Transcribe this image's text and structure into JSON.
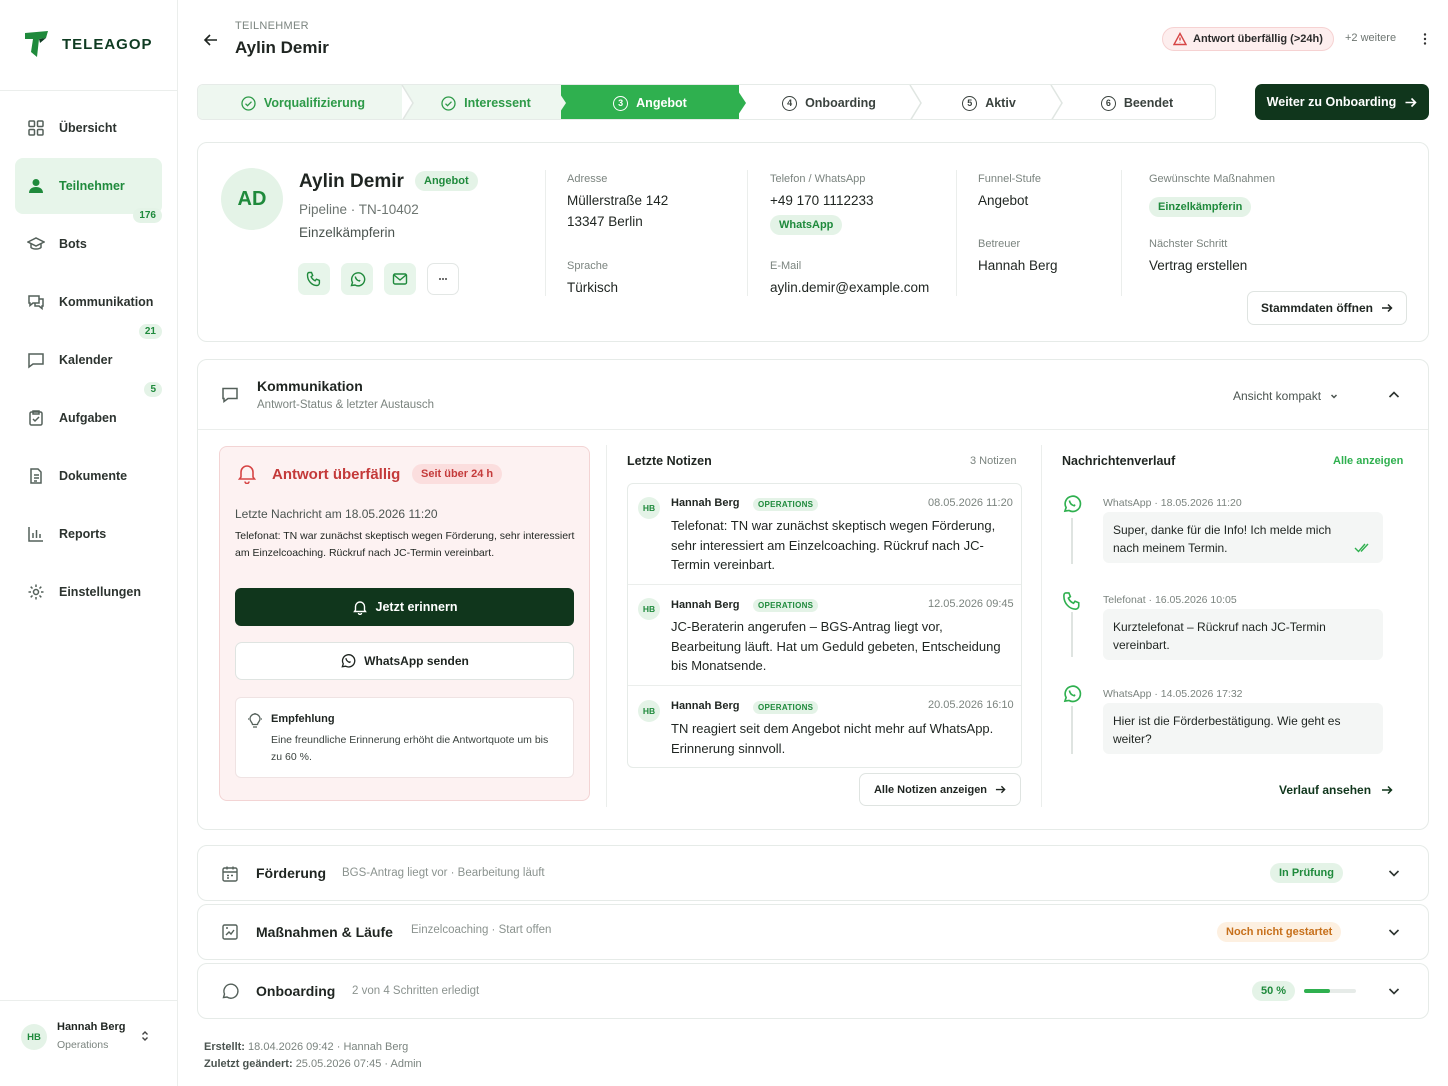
{
  "brand": {
    "name": "TELEAGOP",
    "colors": {
      "primary": "#2fb04f",
      "dark": "#10361c",
      "danger": "#d64545",
      "warning": "#c7701b"
    }
  },
  "sidebar": {
    "items": [
      {
        "label": "Übersicht",
        "icon": "grid-icon"
      },
      {
        "label": "Teilnehmer",
        "icon": "user-icon",
        "badge": "176",
        "active": true
      },
      {
        "label": "Bots",
        "icon": "graduation-cap-icon"
      },
      {
        "label": "Kommunikation",
        "icon": "chat-icon",
        "badge": "21"
      },
      {
        "label": "Kalender",
        "icon": "message-square-icon",
        "badge": "5"
      },
      {
        "label": "Aufgaben",
        "icon": "clipboard-check-icon"
      },
      {
        "label": "Dokumente",
        "icon": "document-icon"
      },
      {
        "label": "Reports",
        "icon": "bar-chart-icon"
      },
      {
        "label": "Einstellungen",
        "icon": "gear-icon"
      }
    ],
    "user": {
      "initials": "HB",
      "name": "Hannah Berg",
      "role": "Operations"
    }
  },
  "header": {
    "kicker": "TEILNEHMER",
    "title": "Aylin Demir",
    "alert": "Antwort überfällig (>24h)",
    "more": "+2 weitere"
  },
  "stepper": {
    "steps": [
      {
        "label": "Vorqualifizierung",
        "state": "done"
      },
      {
        "label": "Interessent",
        "state": "done"
      },
      {
        "num": "3",
        "label": "Angebot",
        "state": "current"
      },
      {
        "num": "4",
        "label": "Onboarding",
        "state": "todo"
      },
      {
        "num": "5",
        "label": "Aktiv",
        "state": "todo"
      },
      {
        "num": "6",
        "label": "Beendet",
        "state": "todo"
      }
    ],
    "next_button": "Weiter zu Onboarding"
  },
  "profile": {
    "initials": "AD",
    "name": "Aylin Demir",
    "status": "Angebot",
    "pipeline": "Pipeline · TN-10402",
    "role": "Einzelkämpferin",
    "address_label": "Adresse",
    "address_line1": "Müllerstraße 142",
    "address_line2": "13347 Berlin",
    "language_label": "Sprache",
    "language": "Türkisch",
    "phone_label": "Telefon / WhatsApp",
    "phone": "+49 170 1112233",
    "phone_tag": "WhatsApp",
    "email_label": "E-Mail",
    "email": "aylin.demir@example.com",
    "funnel_label": "Funnel-Stufe",
    "funnel": "Angebot",
    "owner_label": "Betreuer",
    "owner": "Hannah Berg",
    "measures_label": "Gewünschte Maßnahmen",
    "measures_tag": "Einzelkämpferin",
    "next_step_label": "Nächster Schritt",
    "next_step": "Vertrag erstellen",
    "master_button": "Stammdaten öffnen"
  },
  "communication": {
    "title": "Kommunikation",
    "subtitle": "Antwort-Status & letzter Austausch",
    "view": "Ansicht kompakt",
    "alert": {
      "title": "Antwort überfällig",
      "tag": "Seit über 24 h",
      "last": "Letzte Nachricht am 18.05.2026 11:20",
      "text": "Telefonat: TN war zunächst skeptisch wegen Förderung, sehr interessiert am Einzelcoaching. Rückruf nach JC-Termin vereinbart.",
      "remind_button": "Jetzt erinnern",
      "whatsapp_button": "WhatsApp senden",
      "rec_title": "Empfehlung",
      "rec_text": "Eine freundliche Erinnerung erhöht die Antwortquote um bis zu 60 %."
    },
    "notes": {
      "title": "Letzte Notizen",
      "count": "3 Notizen",
      "items": [
        {
          "initials": "HB",
          "author": "Hannah Berg",
          "team": "OPERATIONS",
          "time": "08.05.2026 11:20",
          "text": "Telefonat: TN war zunächst skeptisch wegen Förderung, sehr interessiert am Einzelcoaching. Rückruf nach JC-Termin vereinbart."
        },
        {
          "initials": "HB",
          "author": "Hannah Berg",
          "team": "OPERATIONS",
          "time": "12.05.2026 09:45",
          "text": "JC-Beraterin angerufen – BGS-Antrag liegt vor, Bearbeitung läuft. Hat um Geduld gebeten, Entscheidung bis Monatsende."
        },
        {
          "initials": "HB",
          "author": "Hannah Berg",
          "team": "OPERATIONS",
          "time": "20.05.2026 16:10",
          "text": "TN reagiert seit dem Angebot nicht mehr auf WhatsApp. Erinnerung sinnvoll."
        }
      ],
      "all_button": "Alle Notizen anzeigen"
    },
    "history": {
      "title": "Nachrichtenverlauf",
      "all_link": "Alle anzeigen",
      "items": [
        {
          "channel": "WhatsApp · 18.05.2026 11:20",
          "text": "Super, danke für die Info! Ich melde mich nach meinem Termin.",
          "icon": "whatsapp-icon"
        },
        {
          "channel": "Telefonat · 16.05.2026 10:05",
          "text": "Kurztelefonat – Rückruf nach JC-Termin vereinbart.",
          "icon": "phone-icon"
        },
        {
          "channel": "WhatsApp · 14.05.2026 17:32",
          "text": "Hier ist die Förderbestätigung. Wie geht es weiter?",
          "icon": "whatsapp-icon"
        }
      ],
      "history_link": "Verlauf ansehen"
    }
  },
  "sections": [
    {
      "title": "Förderung",
      "subtitle": "BGS-Antrag liegt vor · Bearbeitung läuft",
      "badge": "In Prüfung",
      "icon": "calendar-icon"
    },
    {
      "title": "Maßnahmen & Läufe",
      "subtitle": "Einzelcoaching · Start offen",
      "badge": "Noch nicht gestartet",
      "icon": "chart-board-icon"
    },
    {
      "title": "Onboarding",
      "subtitle": "2 von 4 Schritten erledigt",
      "badge": "50 %",
      "progress": 0.5,
      "icon": "chat-bubble-icon"
    }
  ],
  "footer": {
    "created_label": "Erstellt:",
    "created": "18.04.2026 09:42 · Hannah Berg",
    "changed_label": "Zuletzt geändert:",
    "changed": "25.05.2026 07:45 · Admin"
  }
}
